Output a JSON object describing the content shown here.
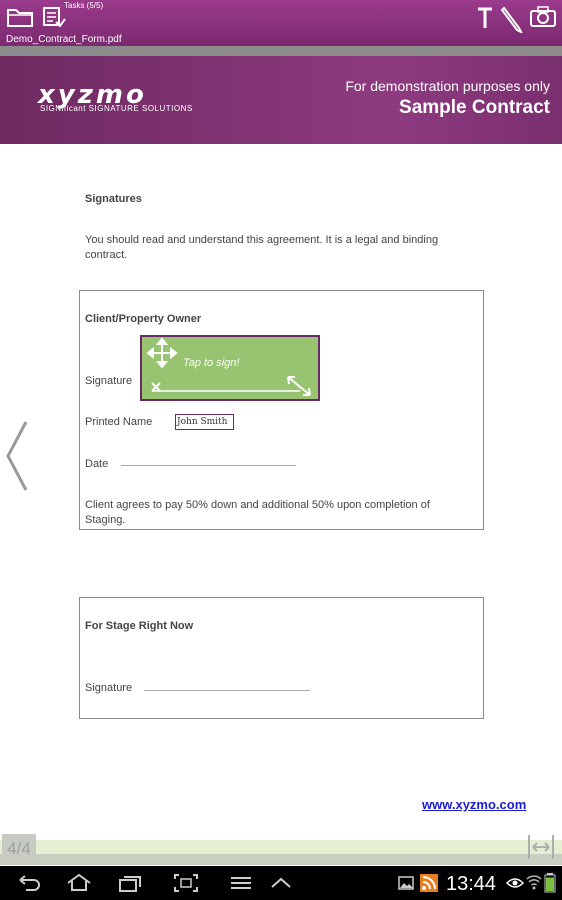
{
  "topbar": {
    "tasks_label": "Tasks (5/5)",
    "filename": "Demo_Contract_Form.pdf",
    "icons": [
      "folder-icon",
      "tasks-icon",
      "text-tool-icon",
      "pen-icon",
      "camera-icon"
    ]
  },
  "banner": {
    "logo_word": "xyzmo",
    "logo_sub": "SIGNificant SIGNATURE SOLUTIONS",
    "demo_line": "For demonstration purposes only",
    "title": "Sample Contract"
  },
  "document": {
    "section_heading": "Signatures",
    "intro_line1": "You should read and understand this agreement. It is a legal and binding",
    "intro_line2": "contract.",
    "client_box": {
      "heading": "Client/Property Owner",
      "signature_label": "Signature",
      "tap_to_sign": "Tap to sign!",
      "printed_name_label": "Printed Name",
      "printed_name_value": "John Smith",
      "date_label": "Date",
      "terms_line1": "Client agrees to pay 50% down and additional 50% upon completion of",
      "terms_line2": "Staging."
    },
    "stage_box": {
      "heading": "For Stage Right Now",
      "signature_label": "Signature"
    },
    "link": "www.xyzmo.com"
  },
  "pager": {
    "page_counter": "4/4"
  },
  "statusbar": {
    "time": "13:44",
    "battery_level": 0.9
  }
}
